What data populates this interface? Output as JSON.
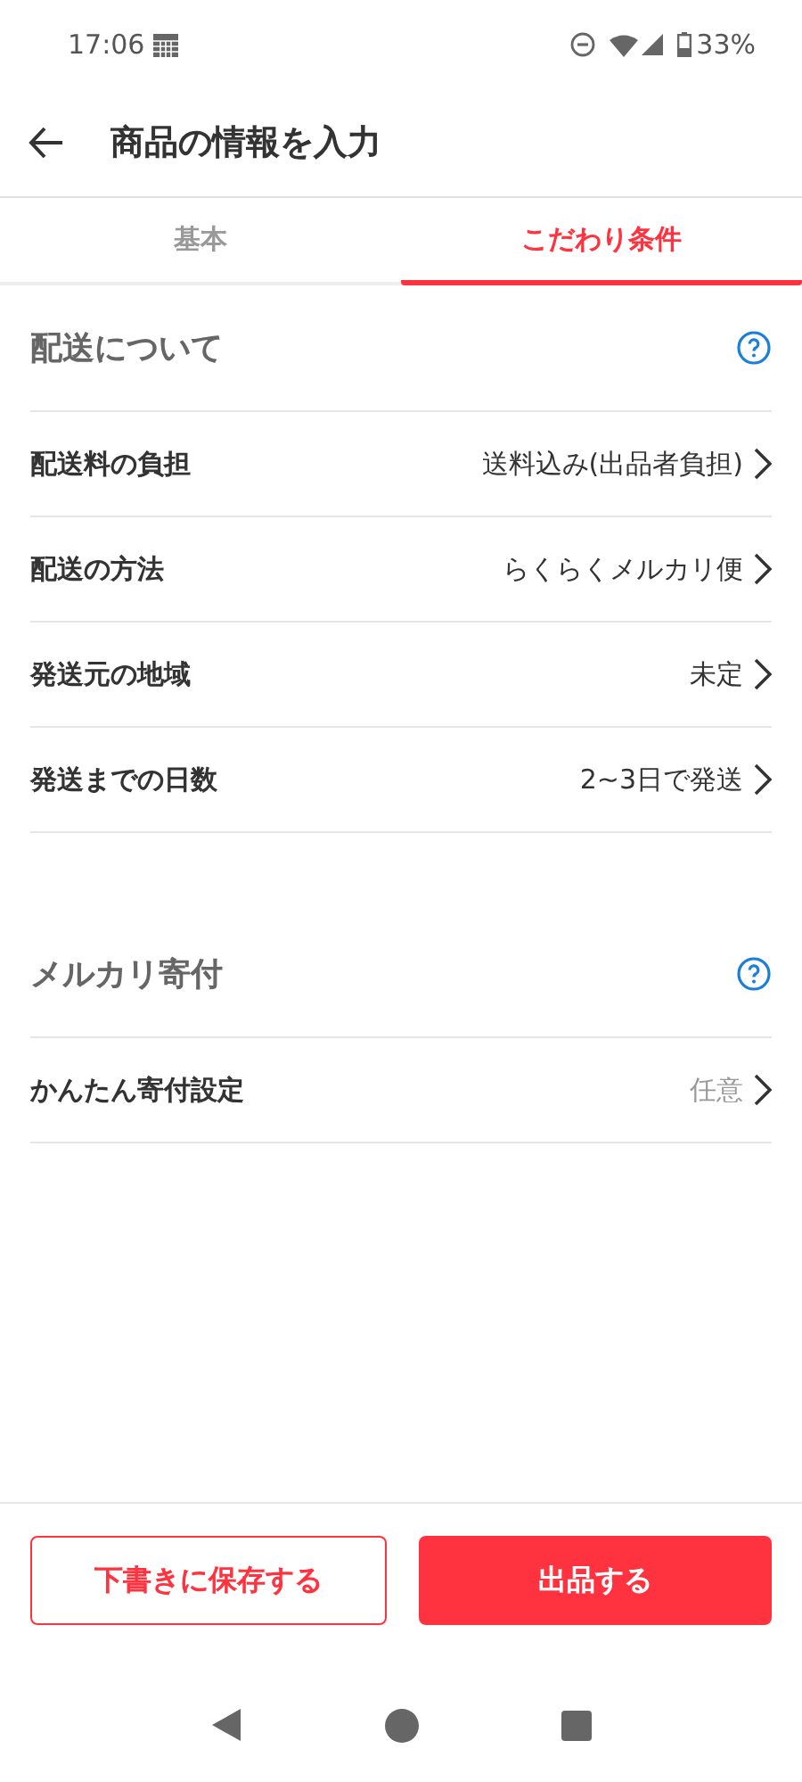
{
  "status_bar": {
    "time": "17:06",
    "battery": "33%"
  },
  "header": {
    "title": "商品の情報を入力"
  },
  "tabs": [
    {
      "label": "基本",
      "selected": false
    },
    {
      "label": "こだわり条件",
      "selected": true
    }
  ],
  "sections": [
    {
      "title": "配送について",
      "rows": [
        {
          "label": "配送料の負担",
          "value": "送料込み(出品者負担)",
          "muted": false
        },
        {
          "label": "配送の方法",
          "value": "らくらくメルカリ便",
          "muted": false
        },
        {
          "label": "発送元の地域",
          "value": "未定",
          "muted": false
        },
        {
          "label": "発送までの日数",
          "value": "2~3日で発送",
          "muted": false
        }
      ]
    },
    {
      "title": "メルカリ寄付",
      "rows": [
        {
          "label": "かんたん寄付設定",
          "value": "任意",
          "muted": true
        }
      ]
    }
  ],
  "buttons": [
    {
      "label": "下書きに保存する",
      "kind": "outline"
    },
    {
      "label": "出品する",
      "kind": "filled"
    }
  ]
}
